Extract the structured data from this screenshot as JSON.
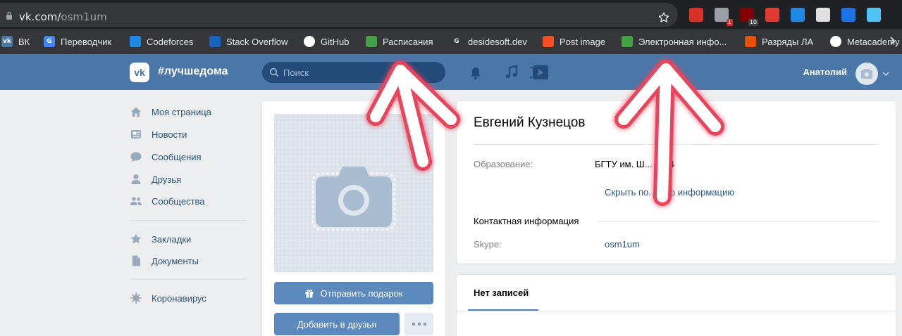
{
  "browser": {
    "url_domain": "vk.com/",
    "url_path": "osm1um",
    "extensions": [
      {
        "name": "gmail-icon",
        "color": "#d93025",
        "badge": ""
      },
      {
        "name": "speed-icon",
        "color": "#9aa0a6",
        "badge": "1"
      },
      {
        "name": "ublock-icon",
        "color": "#800000",
        "badge": "10"
      },
      {
        "name": "shield-icon",
        "color": "#e53935",
        "badge": ""
      },
      {
        "name": "s-icon",
        "color": "#1e88e5",
        "badge": ""
      },
      {
        "name": "spy-icon",
        "color": "#e0e0e0",
        "badge": ""
      },
      {
        "name": "share-icon",
        "color": "#1a73e8",
        "badge": ""
      },
      {
        "name": "profile-icon",
        "color": "#4fc3f7",
        "badge": ""
      }
    ]
  },
  "bookmarks": [
    {
      "label": "ВК",
      "icon": "vk-icon",
      "color": "#4a76a8",
      "glyph": "vk"
    },
    {
      "label": "Переводчик",
      "icon": "translate-icon",
      "color": "#4285f4",
      "glyph": "G"
    },
    {
      "label": "Codeforces",
      "icon": "codeforces-icon",
      "color": "#1e88e5",
      "glyph": ""
    },
    {
      "label": "Stack Overflow",
      "icon": "stackoverflow-icon",
      "color": "#1565c0",
      "glyph": ""
    },
    {
      "label": "GitHub",
      "icon": "github-icon",
      "color": "#ffffff",
      "glyph": ""
    },
    {
      "label": "Расписания",
      "icon": "schedule-icon",
      "color": "#43a047",
      "glyph": ""
    },
    {
      "label": "desidesoft.dev",
      "icon": "desidesoft-icon",
      "color": "#35363a",
      "glyph": "G"
    },
    {
      "label": "Post image",
      "icon": "postimage-icon",
      "color": "#f4511e",
      "glyph": ""
    },
    {
      "label": "Электронная инфо...",
      "icon": "education-icon",
      "color": "#43a047",
      "glyph": ""
    },
    {
      "label": "Разряды ЛА",
      "icon": "athletics-icon",
      "color": "#e65100",
      "glyph": ""
    },
    {
      "label": "Metacademy",
      "icon": "globe-icon",
      "color": "#ffffff",
      "glyph": ""
    }
  ],
  "header": {
    "logo_text": "vk",
    "hashtag": "#лучшедома",
    "search_placeholder": "Поиск",
    "user_name": "Анатолий"
  },
  "sidebar": {
    "items": [
      {
        "label": "Моя страница",
        "icon": "home-icon"
      },
      {
        "label": "Новости",
        "icon": "news-icon"
      },
      {
        "label": "Сообщения",
        "icon": "messages-icon"
      },
      {
        "label": "Друзья",
        "icon": "friends-icon"
      },
      {
        "label": "Сообщества",
        "icon": "communities-icon"
      },
      {
        "label": "Закладки",
        "icon": "bookmarks-icon"
      },
      {
        "label": "Документы",
        "icon": "documents-icon"
      },
      {
        "label": "Коронавирус",
        "icon": "coronavirus-icon"
      }
    ]
  },
  "profile": {
    "name": "Евгений Кузнецов",
    "education_label": "Образование:",
    "education_value": "БГТУ им. Ш... а '14",
    "hide_info_link": "Скрыть по... ную информацию",
    "contact_title": "Контактная информация",
    "skype_label": "Skype:",
    "skype_value": "osm1um",
    "gift_button": "Отправить подарок",
    "add_friend_button": "Добавить в друзья"
  },
  "wall": {
    "tab_label": "Нет записей"
  },
  "colors": {
    "vk_blue": "#4a76a8",
    "button_blue": "#5b88bd",
    "arrow_red": "#e8455d"
  }
}
